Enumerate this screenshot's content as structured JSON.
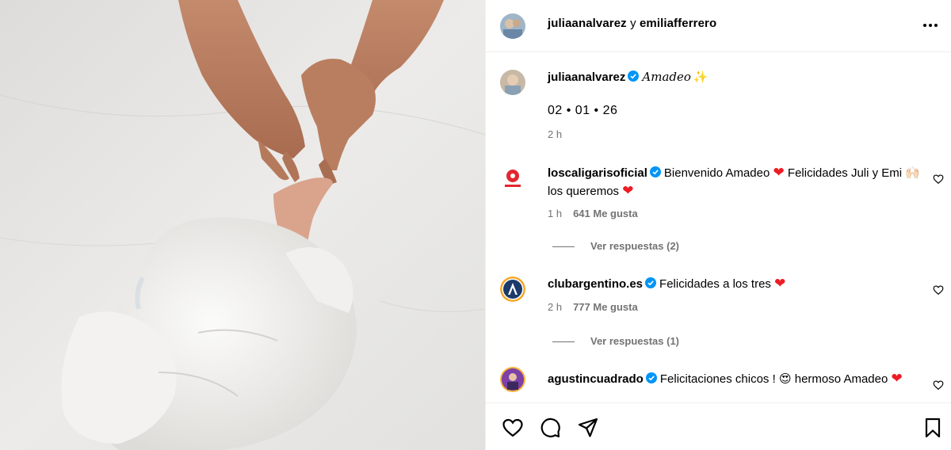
{
  "post": {
    "header": {
      "author": "juliaanalvarez",
      "joiner": " y ",
      "coauthor": "emiliafferrero"
    },
    "caption": {
      "username": "juliaanalvarez",
      "text": "Amadeo",
      "date": "02 • 01 • 26",
      "time": "2 h"
    },
    "comments": [
      {
        "username": "loscaligarisoficial",
        "text_a": "Bienvenido Amadeo",
        "text_b": "Felicidades Juli y Emi ",
        "text_c": "los queremos",
        "time": "1 h",
        "likes": "641 Me gusta",
        "replies": "Ver respuestas (2)"
      },
      {
        "username": "clubargentino.es",
        "text_a": "Felicidades a los tres",
        "time": "2 h",
        "likes": "777 Me gusta",
        "replies": "Ver respuestas (1)"
      },
      {
        "username": "agustincuadrado",
        "text_a": "Felicitaciones chicos !",
        "text_b": "hermoso Amadeo"
      }
    ],
    "icons": {
      "more": "more-options-icon",
      "like": "heart-outline-icon",
      "comment": "comment-bubble-icon",
      "share": "paper-plane-icon",
      "save": "bookmark-icon",
      "verified": "verified-badge-icon"
    },
    "colors": {
      "verified": "#0095f6",
      "heart": "#ed1c24",
      "muted": "#737373"
    }
  }
}
